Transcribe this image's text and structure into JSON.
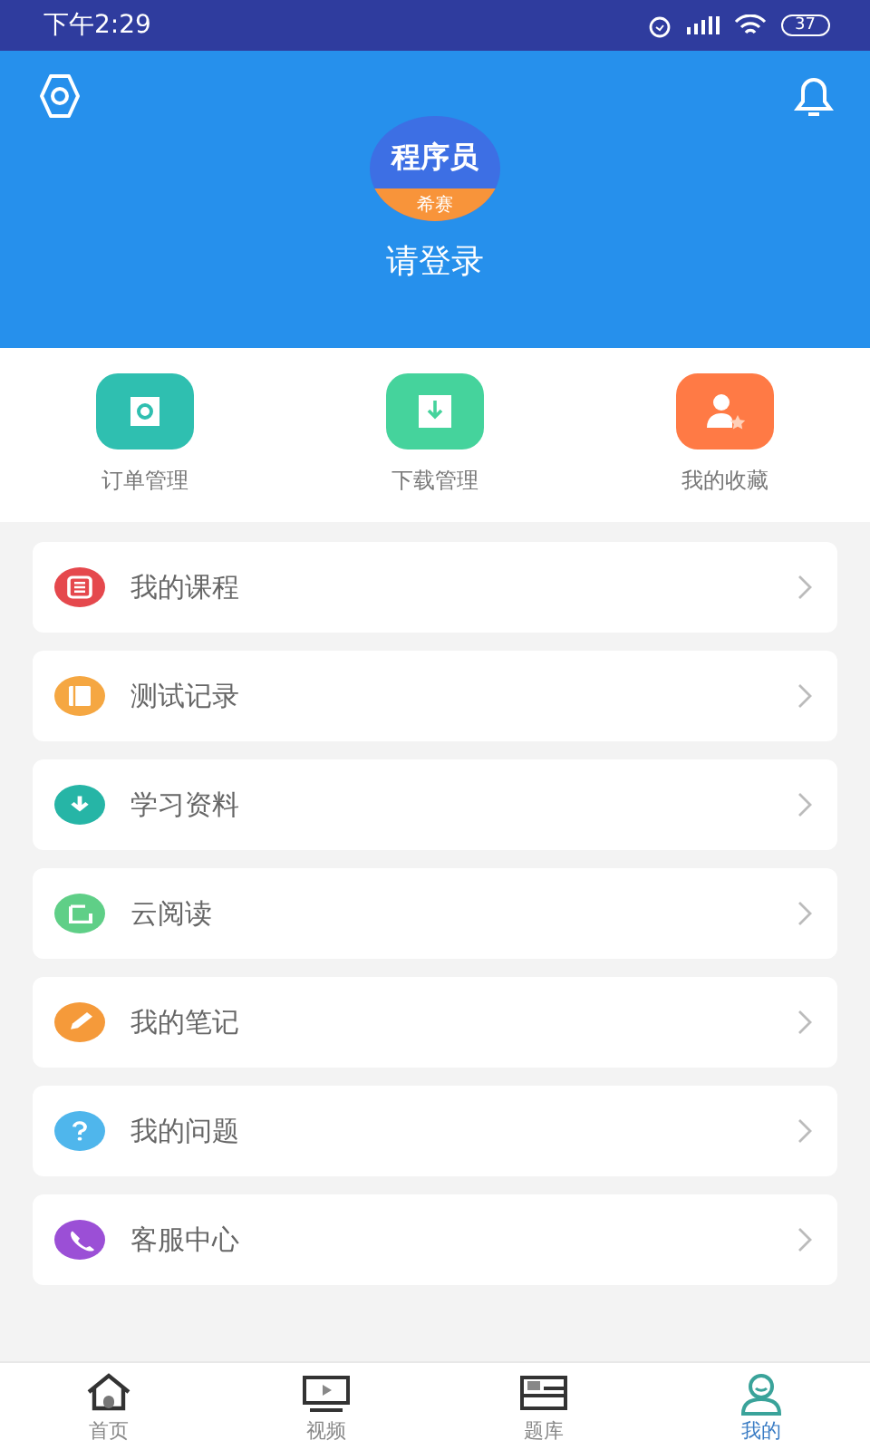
{
  "status_bar": {
    "time": "下午2:29",
    "battery": "37"
  },
  "header": {
    "logo": {
      "title": "程序员",
      "subtitle": "希赛"
    },
    "login": "请登录"
  },
  "quick_actions": [
    {
      "label": "订单管理",
      "kind": "order",
      "color": "#2fbfb0"
    },
    {
      "label": "下载管理",
      "kind": "download",
      "color": "#45d39c"
    },
    {
      "label": "我的收藏",
      "kind": "favorite",
      "color": "#ff7a45"
    }
  ],
  "menu": [
    {
      "label": "我的课程",
      "kind": "list",
      "color": "#e5484d"
    },
    {
      "label": "测试记录",
      "kind": "notebook",
      "color": "#f5a742"
    },
    {
      "label": "学习资料",
      "kind": "download",
      "color": "#26b5a6"
    },
    {
      "label": "云阅读",
      "kind": "reader",
      "color": "#5fcf87"
    },
    {
      "label": "我的笔记",
      "kind": "pencil",
      "color": "#f59a3a"
    },
    {
      "label": "我的问题",
      "kind": "question",
      "color": "#4fb6ec"
    },
    {
      "label": "客服中心",
      "kind": "phone",
      "color": "#9b4fd6"
    }
  ],
  "tabs": [
    {
      "label": "首页",
      "kind": "home",
      "selected": false
    },
    {
      "label": "视频",
      "kind": "video",
      "selected": false
    },
    {
      "label": "题库",
      "kind": "bank",
      "selected": false
    },
    {
      "label": "我的",
      "kind": "me",
      "selected": true
    }
  ]
}
